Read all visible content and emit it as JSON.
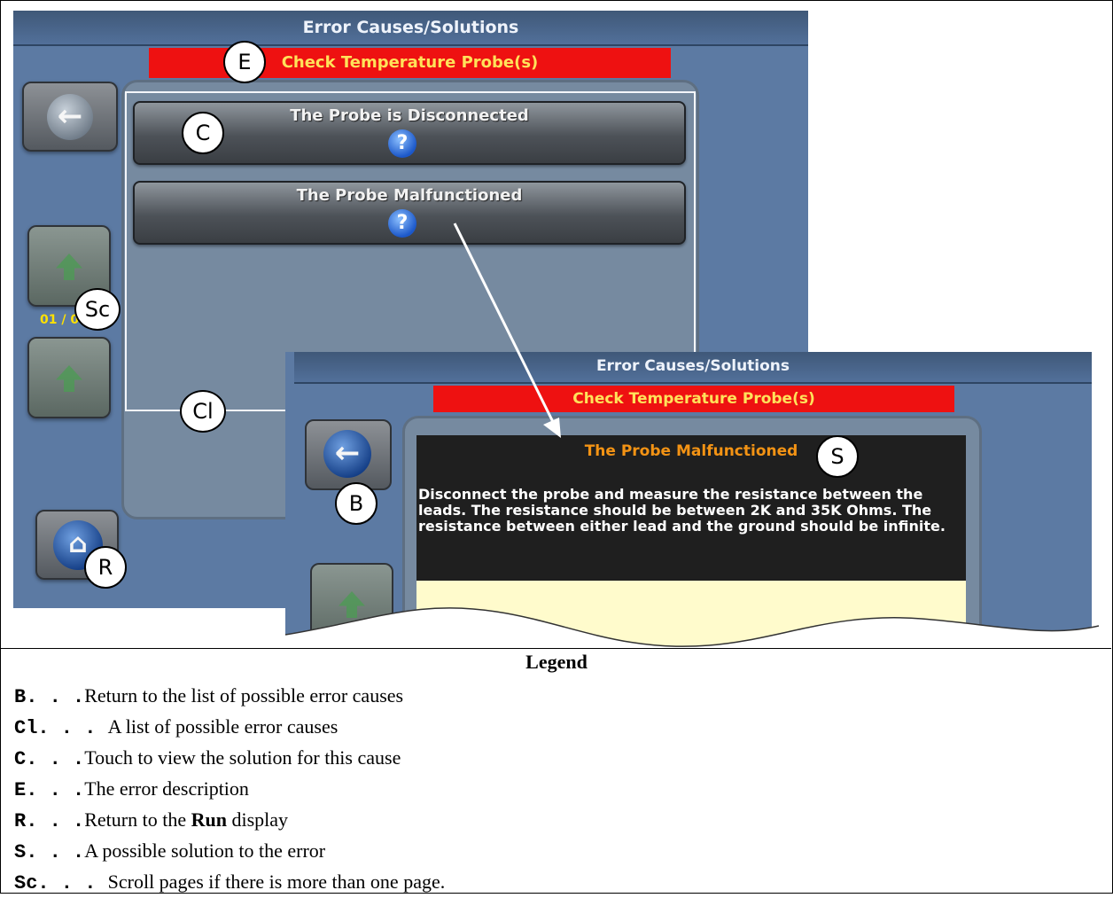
{
  "screen1": {
    "title": "Error Causes/Solutions",
    "error": "Check Temperature Probe(s)",
    "causes": [
      {
        "label": "The Probe is Disconnected",
        "icon": "question-icon"
      },
      {
        "label": "The Probe Malfunctioned",
        "icon": "question-icon"
      }
    ],
    "page_counter": "01 / 0",
    "icons": {
      "back": "back-arrow-icon",
      "up": "scroll-up-icon",
      "down": "scroll-down-icon",
      "home": "home-icon"
    }
  },
  "screen2": {
    "title": "Error Causes/Solutions",
    "error": "Check Temperature Probe(s)",
    "solution_title": "The Probe Malfunctioned",
    "solution_text": "Disconnect the probe and measure the resistance between the leads. The resistance should be between 2K and 35K Ohms. The resistance between either lead and the ground should be infinite."
  },
  "callouts": {
    "E": "E",
    "C": "C",
    "Sc": "Sc",
    "Cl": "Cl",
    "R": "R",
    "S": "S",
    "B": "B"
  },
  "legend": {
    "title": "Legend",
    "items": [
      {
        "key": "B. . .",
        "text": "Return to the list of possible error causes"
      },
      {
        "key": "Cl. . . ",
        "text": "A list of possible error causes"
      },
      {
        "key": "C. . .",
        "text": "Touch to view the solution for this cause"
      },
      {
        "key": "E. . .",
        "text": "The error description"
      },
      {
        "key": "R. . .",
        "text_before": "Return to the ",
        "text_bold": "Run",
        "text_after": " display"
      },
      {
        "key": "S. . .",
        "text": "A possible solution to the error"
      },
      {
        "key": "Sc. . . ",
        "text": "Scroll pages if there is more than one page."
      }
    ]
  },
  "colors": {
    "screen_bg": "#5c7aa3",
    "error_bar": "#ee1111",
    "error_text": "#ffe25a",
    "solution_title": "#f39314",
    "page_counter": "#ffe100"
  }
}
